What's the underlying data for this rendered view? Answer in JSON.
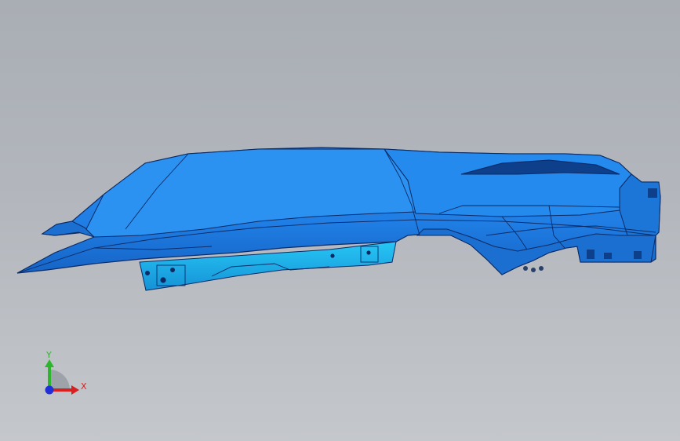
{
  "viewport": {
    "background_top": "#a9adb4",
    "background_bottom": "#c4c7cb"
  },
  "model": {
    "icon": "car-fender-part-icon",
    "face_color": "#1e7fe6",
    "highlight_color": "#2aa0ff",
    "edge_color": "#0a2a66",
    "flange_color": "#1fb8f0"
  },
  "triad": {
    "y_label": "Y",
    "x_label": "X",
    "y_color": "#2db52d",
    "x_color": "#d82020",
    "z_color": "#2030d8"
  }
}
